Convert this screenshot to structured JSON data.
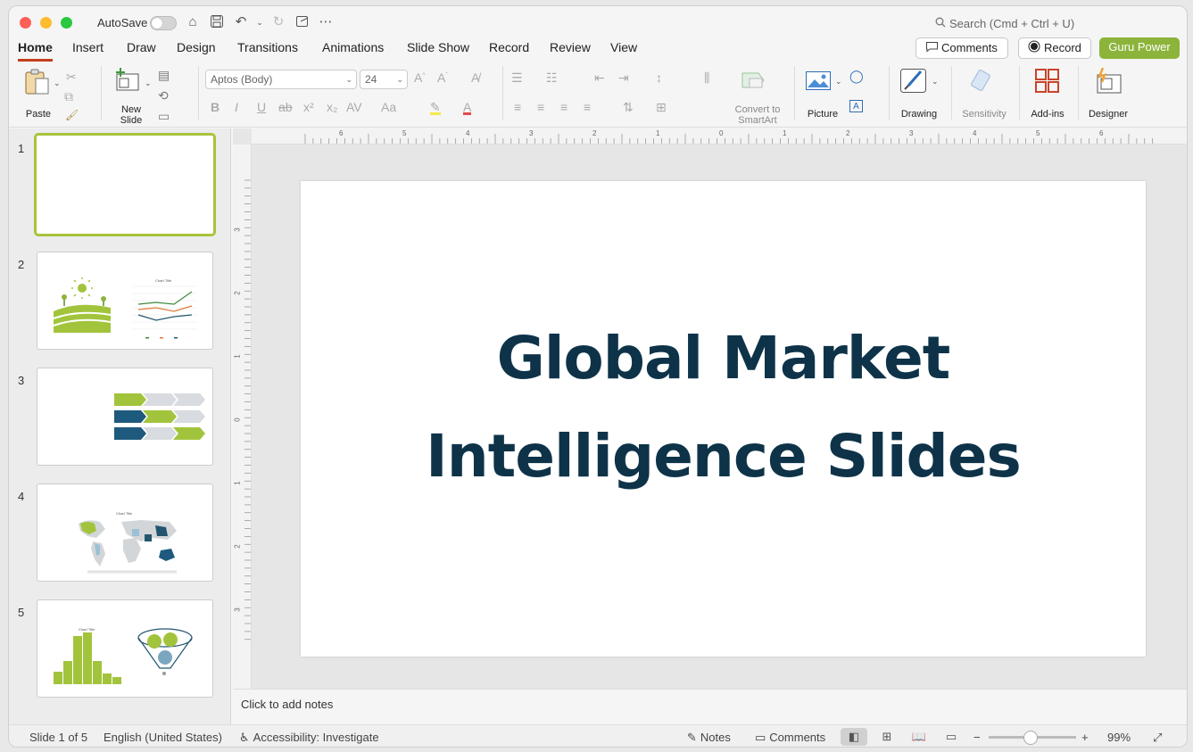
{
  "titlebar": {
    "autosave_label": "AutoSave",
    "search_placeholder": "Search (Cmd + Ctrl + U)"
  },
  "tabs": [
    "Home",
    "Insert",
    "Draw",
    "Design",
    "Transitions",
    "Animations",
    "Slide Show",
    "Record",
    "Review",
    "View"
  ],
  "active_tab": "Home",
  "top_buttons": {
    "comments": "Comments",
    "record": "Record",
    "guru": "Guru Power"
  },
  "ribbon": {
    "paste": "Paste",
    "new_slide_line1": "New",
    "new_slide_line2": "Slide",
    "font_name": "Aptos (Body)",
    "font_size": "24",
    "convert_line1": "Convert to",
    "convert_line2": "SmartArt",
    "picture": "Picture",
    "drawing": "Drawing",
    "sensitivity": "Sensitivity",
    "addins": "Add-ins",
    "designer": "Designer"
  },
  "thumbnails": [
    {
      "num": "1"
    },
    {
      "num": "2",
      "chart_title": "Chart Title"
    },
    {
      "num": "3"
    },
    {
      "num": "4",
      "chart_title": "Chart Title"
    },
    {
      "num": "5",
      "chart_title": "Chart Title"
    }
  ],
  "slide": {
    "title_line1": "Global Market",
    "title_line2": "Intelligence Slides"
  },
  "ruler": {
    "h_ticks": [
      "6",
      "5",
      "4",
      "3",
      "2",
      "1",
      "0",
      "1",
      "2",
      "3",
      "4",
      "5",
      "6"
    ],
    "v_ticks": [
      "3",
      "2",
      "1",
      "0",
      "1",
      "2",
      "3"
    ]
  },
  "notes_placeholder": "Click to add notes",
  "status": {
    "slide_info": "Slide 1 of 5",
    "language": "English (United States)",
    "accessibility": "Accessibility: Investigate",
    "notes": "Notes",
    "comments": "Comments",
    "zoom": "99%"
  },
  "colors": {
    "accent": "#c43e1c",
    "guru": "#8cb43b",
    "title": "#0e3349",
    "selection": "#a7c43c"
  }
}
